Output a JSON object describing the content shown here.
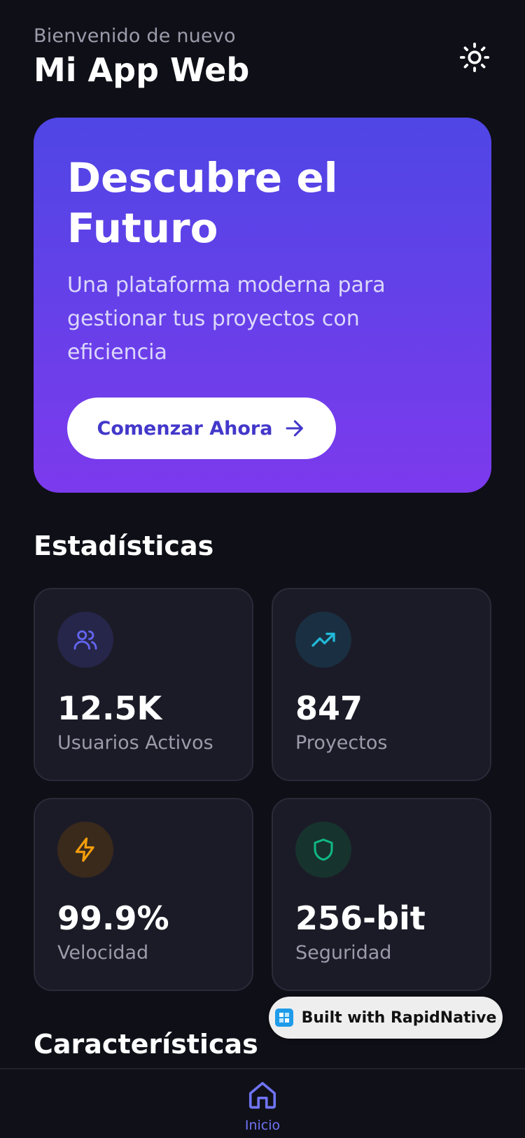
{
  "header": {
    "greeting": "Bienvenido de nuevo",
    "title": "Mi App Web",
    "theme_icon": "sun-icon"
  },
  "hero": {
    "title_line1": "Descubre el",
    "title_line2": "Futuro",
    "subtitle": "Una plataforma moderna para gestionar tus proyectos con eficiencia",
    "button_label": "Comenzar Ahora",
    "button_icon": "arrow-right-icon",
    "gradient_start": "#4f46e5",
    "gradient_end": "#7c3aed"
  },
  "stats": {
    "section_title": "Estadísticas",
    "items": [
      {
        "icon": "users-icon",
        "value": "12.5K",
        "label": "Usuarios Activos",
        "color": "#6366f1"
      },
      {
        "icon": "trending-up-icon",
        "value": "847",
        "label": "Proyectos",
        "color": "#22b8d8"
      },
      {
        "icon": "lightning-icon",
        "value": "99.9%",
        "label": "Velocidad",
        "color": "#f59e0b"
      },
      {
        "icon": "shield-icon",
        "value": "256-bit",
        "label": "Seguridad",
        "color": "#10b981"
      }
    ]
  },
  "features": {
    "section_title": "Características"
  },
  "badge": {
    "label": "Built with RapidNative"
  },
  "bottom_nav": {
    "items": [
      {
        "icon": "home-icon",
        "label": "Inicio",
        "active": true
      }
    ]
  }
}
